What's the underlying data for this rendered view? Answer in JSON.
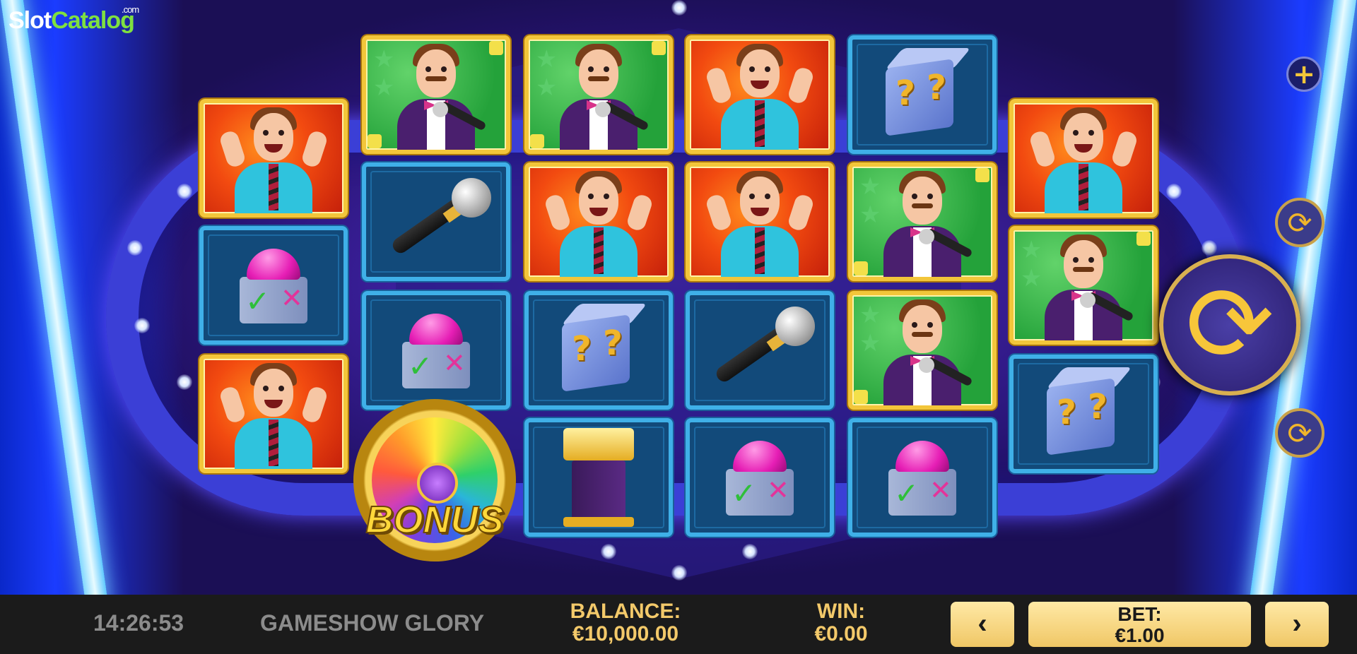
{
  "logo": {
    "text_main": "Slot",
    "text_accent": "Catalog",
    "suffix": ".com"
  },
  "game": {
    "title": "GAMESHOW GLORY"
  },
  "clock": "14:26:53",
  "balance": {
    "label": "BALANCE:",
    "value": "€10,000.00"
  },
  "win": {
    "label": "WIN:",
    "value": "€0.00"
  },
  "bet": {
    "label": "BET:",
    "value": "€1.00",
    "prev": "‹",
    "next": "›"
  },
  "controls": {
    "plus": "+",
    "spin": "⟳",
    "turbo": "⟳",
    "autoplay": "⟳"
  },
  "bonus": {
    "label": "BONUS"
  },
  "reels": [
    [
      "host-cheer",
      "buzzer",
      "host-cheer"
    ],
    [
      "host-mic",
      "microphone",
      "buzzer",
      "bonus-wheel"
    ],
    [
      "host-mic",
      "host-cheer",
      "mystery-cube",
      "podium"
    ],
    [
      "host-cheer",
      "host-cheer",
      "microphone",
      "buzzer"
    ],
    [
      "mystery-cube",
      "host-mic",
      "host-mic",
      "buzzer"
    ],
    [
      "host-cheer",
      "host-mic",
      "mystery-cube"
    ]
  ]
}
